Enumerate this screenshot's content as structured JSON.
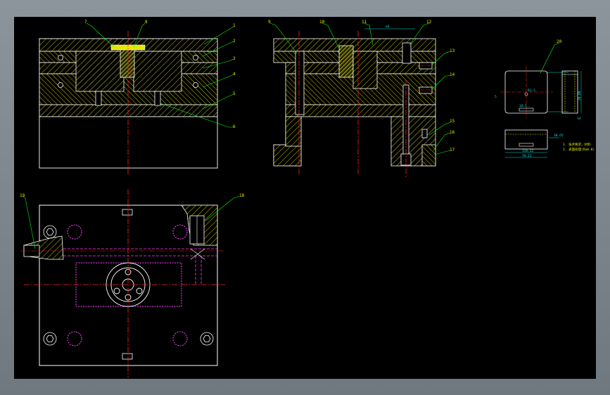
{
  "drawing": {
    "part_labels": [
      "1",
      "2",
      "3",
      "4",
      "5",
      "6",
      "7",
      "8",
      "9",
      "10",
      "11",
      "12",
      "13",
      "14",
      "15",
      "16",
      "17",
      "18",
      "19",
      "20"
    ],
    "dimension_labels": [
      "18.5",
      "ø4",
      "20.08",
      "14",
      "30.65",
      "120.12",
      "70.12",
      "R1.5",
      "5",
      "18.5"
    ],
    "notes": [
      "1. 技术要求，材料",
      "2. 表面处理(Ra0.8)"
    ]
  },
  "colors": {
    "background": "#000000",
    "outline": "#ffffff",
    "hatch": "#e6e600",
    "centerline": "#ff2020",
    "hidden": "#ff40ff",
    "dimension": "#00e0e0",
    "leader": "#00ff00"
  }
}
